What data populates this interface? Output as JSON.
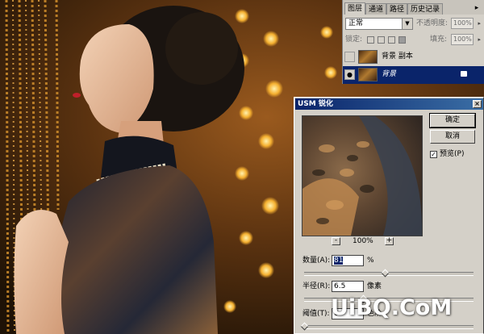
{
  "colors": {
    "panel_bg": "#d4d0c8",
    "selection": "#0a246a",
    "title_start": "#0a246a",
    "title_end": "#3a6ea5"
  },
  "layers_panel": {
    "tabs": [
      "图层",
      "通道",
      "路径",
      "历史记录"
    ],
    "menu_icon": "menu-arrow-icon",
    "blend_mode": "正常",
    "opacity_label": "不透明度:",
    "opacity_value": "100%",
    "lock_label": "锁定:",
    "fill_label": "填充:",
    "fill_value": "100%",
    "layers": [
      {
        "name": "背景 副本",
        "visible": false,
        "selected": false
      },
      {
        "name": "背景",
        "visible": true,
        "selected": true
      }
    ]
  },
  "dialog": {
    "title": "USM 锐化",
    "close": "×",
    "ok": "确定",
    "cancel": "取消",
    "preview_label": "预览(P)",
    "preview_checked": true,
    "zoom_out": "-",
    "zoom_in": "+",
    "zoom": "100%",
    "amount_label": "数量(A):",
    "amount_value": "81",
    "amount_unit": "%",
    "radius_label": "半径(R):",
    "radius_value": "6.5",
    "radius_unit": "像素",
    "threshold_label": "阈值(T):",
    "threshold_value": "0",
    "threshold_unit": "色阶"
  },
  "watermark": "UiBQ.CoM"
}
